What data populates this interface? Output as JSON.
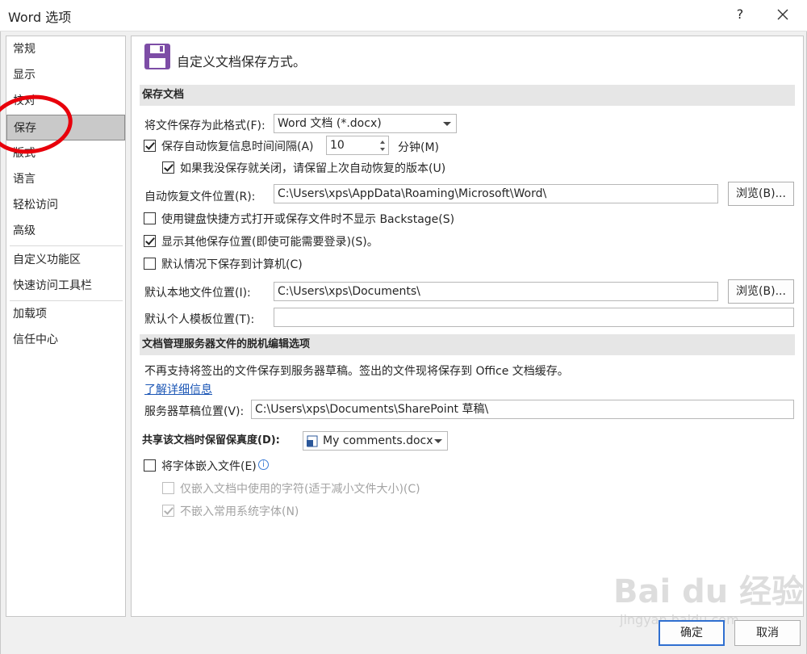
{
  "window": {
    "title": "Word 选项",
    "help": "?"
  },
  "nav": [
    {
      "label": "常规"
    },
    {
      "label": "显示"
    },
    {
      "label": "校对"
    },
    {
      "label": "保存"
    },
    {
      "label": "版式"
    },
    {
      "label": "语言"
    },
    {
      "label": "轻松访问"
    },
    {
      "label": "高级"
    },
    {
      "label": "自定义功能区"
    },
    {
      "label": "快速访问工具栏"
    },
    {
      "label": "加载项"
    },
    {
      "label": "信任中心"
    }
  ],
  "nav_selected": "保存",
  "header": {
    "title": "自定义文档保存方式。",
    "icon": "save-floppy-icon",
    "icon_color": "#7d4da6"
  },
  "sections": {
    "save_docs": "保存文档",
    "offline": "文档管理服务器文件的脱机编辑选项",
    "fidelity": "共享该文档时保留保真度(D):"
  },
  "save": {
    "format_label": "将文件保存为此格式(F):",
    "format_value": "Word 文档 (*.docx)",
    "autorecover_label": "保存自动恢复信息时间间隔(A)",
    "autorecover_checked": true,
    "autorecover_minutes": "10",
    "minutes_unit": "分钟(M)",
    "keep_last_label": "如果我没保存就关闭，请保留上次自动恢复的版本(U)",
    "keep_last_checked": true,
    "autorecover_path_label": "自动恢复文件位置(R):",
    "autorecover_path": "C:\\Users\\xps\\AppData\\Roaming\\Microsoft\\Word\\",
    "browse": "浏览(B)...",
    "no_backstage_label": "使用键盘快捷方式打开或保存文件时不显示 Backstage(S)",
    "no_backstage_checked": false,
    "show_more_label": "显示其他保存位置(即使可能需要登录)(S)。",
    "show_more_checked": true,
    "save_to_computer_label": "默认情况下保存到计算机(C)",
    "save_to_computer_checked": false,
    "local_path_label": "默认本地文件位置(I):",
    "local_path": "C:\\Users\\xps\\Documents\\",
    "template_path_label": "默认个人模板位置(T):",
    "template_path": ""
  },
  "offline": {
    "note": "不再支持将签出的文件保存到服务器草稿。签出的文件现将保存到 Office 文档缓存。",
    "learn_more": "了解详细信息",
    "drafts_label": "服务器草稿位置(V):",
    "drafts_path": "C:\\Users\\xps\\Documents\\SharePoint 草稿\\"
  },
  "fidelity": {
    "document": "My comments.docx",
    "embed_fonts_label": "将字体嵌入文件(E)",
    "embed_fonts_checked": false,
    "embed_used_label": "仅嵌入文档中使用的字符(适于减小文件大小)(C)",
    "no_common_label": "不嵌入常用系统字体(N)"
  },
  "footer": {
    "ok": "确定",
    "cancel": "取消"
  },
  "watermark": {
    "brand": "Bai du 经验",
    "url": "jingyan.baidu.com"
  }
}
